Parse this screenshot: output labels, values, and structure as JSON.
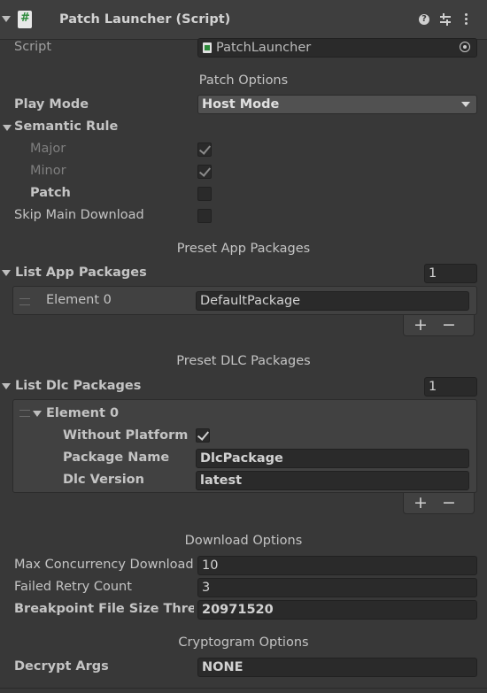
{
  "header": {
    "title": "Patch Launcher (Script)"
  },
  "script_row": {
    "label": "Script",
    "value": "PatchLauncher"
  },
  "patch_options": {
    "section_title": "Patch Options",
    "play_mode": {
      "label": "Play Mode",
      "value": "Host Mode"
    },
    "semantic_rule": {
      "label": "Semantic Rule"
    },
    "major": {
      "label": "Major",
      "checked": true
    },
    "minor": {
      "label": "Minor",
      "checked": true
    },
    "patch": {
      "label": "Patch",
      "checked": false
    },
    "skip_main_download": {
      "label": "Skip Main Download",
      "checked": false
    }
  },
  "preset_app": {
    "section_title": "Preset App Packages",
    "list_label": "List App Packages",
    "count": "1",
    "element_label": "Element 0",
    "element_value": "DefaultPackage"
  },
  "preset_dlc": {
    "section_title": "Preset DLC Packages",
    "list_label": "List Dlc Packages",
    "count": "1",
    "element_label": "Element 0",
    "without_platform": {
      "label": "Without Platform",
      "checked": true
    },
    "package_name": {
      "label": "Package Name",
      "value": "DlcPackage"
    },
    "dlc_version": {
      "label": "Dlc Version",
      "value": "latest"
    }
  },
  "download_options": {
    "section_title": "Download Options",
    "max_concurrency": {
      "label": "Max Concurrency Download",
      "value": "10"
    },
    "failed_retry": {
      "label": "Failed Retry Count",
      "value": "3"
    },
    "breakpoint": {
      "label": "Breakpoint File Size Thresh",
      "value": "20971520"
    }
  },
  "cryptogram_options": {
    "section_title": "Cryptogram Options",
    "decrypt_args": {
      "label": "Decrypt Args",
      "value": "NONE"
    }
  },
  "list_buttons": {
    "add": "+",
    "remove": "−"
  },
  "icons": [
    "foldout-arrow-icon",
    "script-file-icon",
    "help-icon",
    "preset-icon",
    "more-options-icon",
    "object-picker-icon",
    "dropdown-arrow-icon",
    "drag-handle-icon"
  ]
}
